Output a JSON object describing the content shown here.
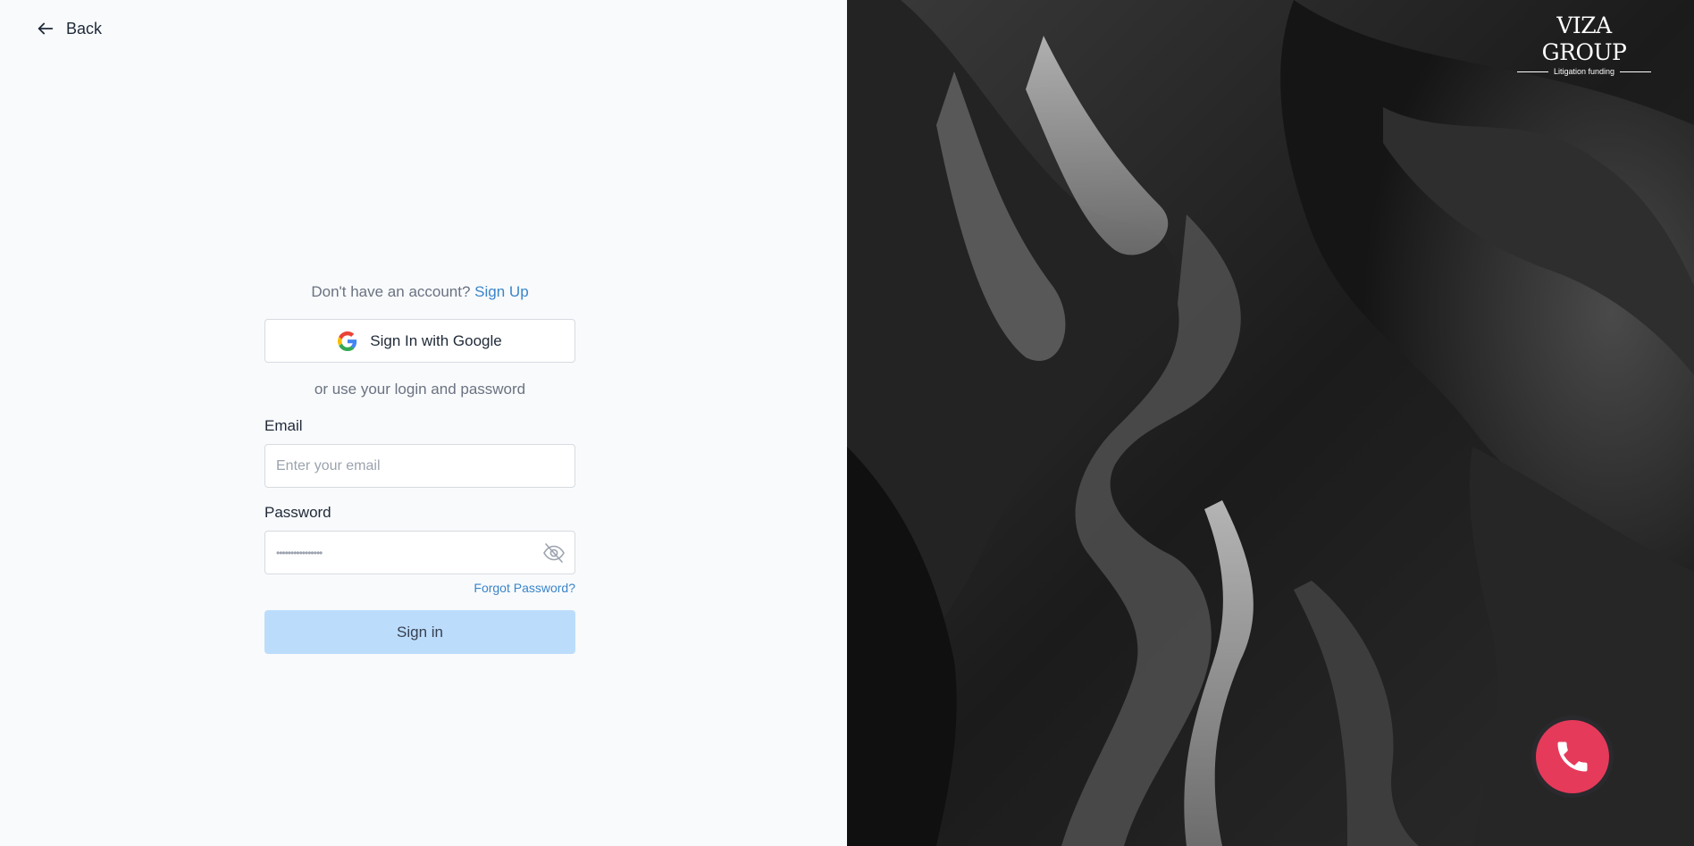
{
  "nav": {
    "back_label": "Back",
    "back_icon": "arrow-left-icon"
  },
  "auth": {
    "signup_prompt": "Don't have an account?",
    "signup_link": "Sign Up",
    "google_button": "Sign In with Google",
    "google_icon": "google-icon",
    "alt_text": "or use your login and password",
    "email_label": "Email",
    "email_placeholder": "Enter your email",
    "email_value": "",
    "password_label": "Password",
    "password_value": "••••••••••••••••",
    "password_toggle_icon": "eye-off-icon",
    "forgot_password": "Forgot Password?",
    "signin_button": "Sign in"
  },
  "brand": {
    "logo_title": "VIZA GROUP",
    "logo_subtitle": "Litigation funding"
  },
  "call_widget": {
    "icon": "phone-icon",
    "color": "#e63a5a"
  },
  "colors": {
    "accent": "#3a85c9",
    "signin_button_bg": "#bcdcfb",
    "page_bg": "#f8fafc"
  }
}
